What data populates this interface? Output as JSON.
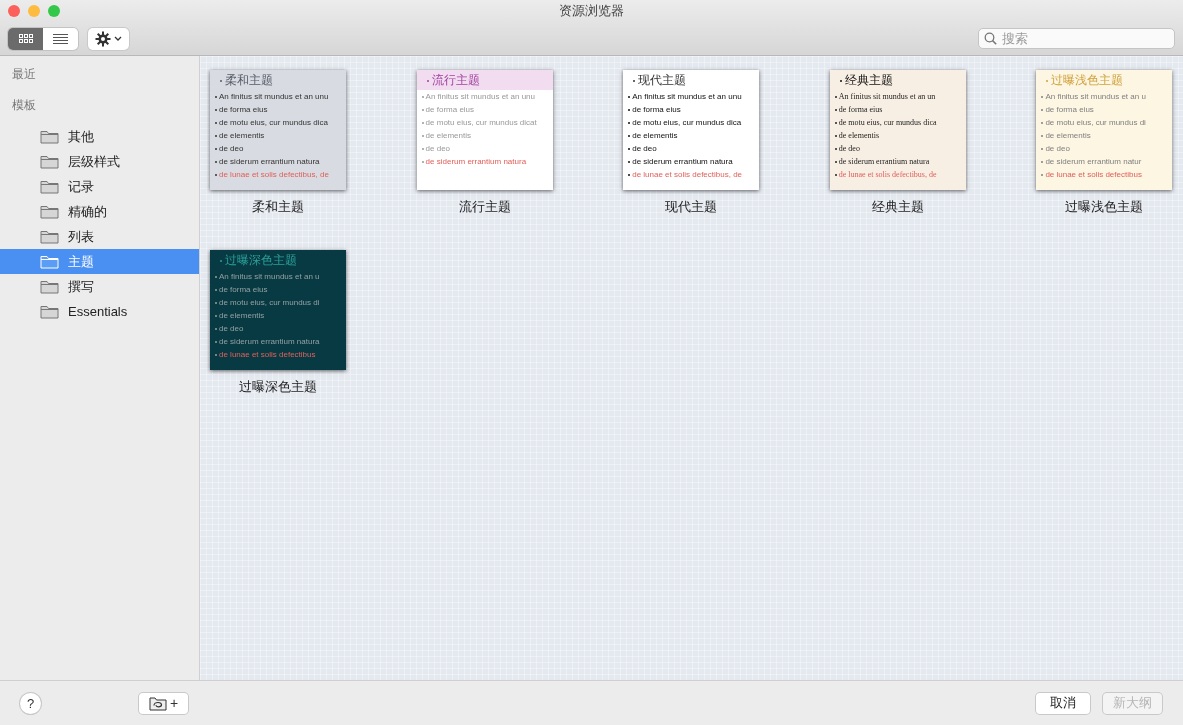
{
  "window": {
    "title": "资源浏览器"
  },
  "toolbar": {
    "view_modes": [
      {
        "kind": "grid",
        "selected": true
      },
      {
        "kind": "list",
        "selected": false
      }
    ],
    "search": {
      "placeholder": "搜索"
    }
  },
  "sidebar": {
    "sections": [
      {
        "heading": "最近"
      },
      {
        "heading": "模板",
        "items": [
          {
            "label": "其他",
            "selected": false
          },
          {
            "label": "层级样式",
            "selected": false
          },
          {
            "label": "记录",
            "selected": false
          },
          {
            "label": "精确的",
            "selected": false
          },
          {
            "label": "列表",
            "selected": false
          },
          {
            "label": "主题",
            "selected": true
          },
          {
            "label": "撰写",
            "selected": false
          },
          {
            "label": "Essentials",
            "selected": false
          }
        ]
      }
    ]
  },
  "themes": [
    {
      "kind": "soft",
      "label": "柔和主题",
      "title": "柔和主题",
      "lines": [
        "An finitus sit mundus et an unu",
        "de forma eius",
        "de motu eius, cur mundus dica",
        "de elementis",
        "de deo",
        "de siderum errantium natura",
        "de lunae et solis defectibus, de"
      ]
    },
    {
      "kind": "popular",
      "label": "流行主题",
      "title": "流行主题",
      "lines": [
        "An finitus sit mundus et an unu",
        "de forma eius",
        "de motu eius, cur mundus dicat",
        "de elementis",
        "de deo",
        "de siderum errantium natura"
      ]
    },
    {
      "kind": "modern",
      "label": "现代主题",
      "title": "现代主题",
      "lines": [
        "An finitus sit mundus et an unu",
        "de forma eius",
        "de motu eius, cur mundus dica",
        "de elementis",
        "de deo",
        "de siderum errantium natura",
        "de lunae et solis defectibus, de"
      ]
    },
    {
      "kind": "classic",
      "label": "经典主题",
      "title": "经典主题",
      "lines": [
        "An finitus sit mundus et an un",
        "de forma eius",
        "de motu eius, cur mundus dica",
        "de elementis",
        "de deo",
        "de siderum errantium natura",
        "de lunae et solis defectibus, de"
      ]
    },
    {
      "kind": "light",
      "label": "过曝浅色主题",
      "title": "过曝浅色主题",
      "lines": [
        "An finitus sit mundus et an u",
        "de forma eius",
        "de motu eius, cur mundus di",
        "de elementis",
        "de deo",
        "de siderum errantium natur",
        "de lunae et solis defectibus"
      ]
    },
    {
      "kind": "dark",
      "label": "过曝深色主题",
      "title": "过曝深色主题",
      "lines": [
        "An finitus sit mundus et an u",
        "de forma eius",
        "de motu eius, cur mundus di",
        "de elementis",
        "de deo",
        "de siderum errantium natura",
        "de lunae et solis defectibus"
      ]
    }
  ],
  "footer": {
    "help": "?",
    "new_folder": "+",
    "buttons": [
      {
        "label": "取消",
        "disabled": false
      },
      {
        "label": "新大纲",
        "disabled": true
      }
    ]
  }
}
